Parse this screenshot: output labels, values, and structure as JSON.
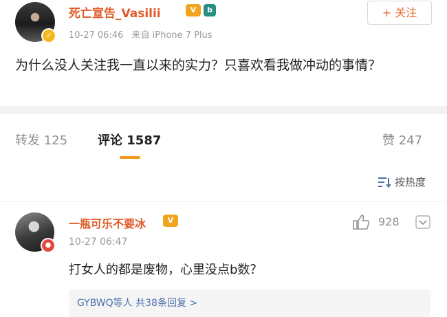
{
  "post": {
    "username": "死亡宣告_Vasilii",
    "vip_icon": "vip-crown-icon",
    "level_icon": "level-badge-icon",
    "avatar_badge": "verified-icon",
    "time": "10-27 06:46",
    "source": "来自 iPhone 7 Plus",
    "follow_label": "+ 关注",
    "text": "为什么没人关注我一直以来的实力？只喜欢看我做冲动的事情？"
  },
  "actions": {
    "repost": "转发 125",
    "comments": "评论 1587",
    "likes": "赞 247",
    "sort_label": "按热度"
  },
  "comment": {
    "username": "一瓶可乐不要冰",
    "time": "10-27 06:47",
    "like_count": "928",
    "text": "打女人的都是废物，心里没点b数？",
    "replies_who": "GYBWQ等人",
    "replies_count": "共38条回复 >"
  },
  "colors": {
    "accent_orange": "#e05a28",
    "tab_underline": "#f39a1e",
    "link_blue": "#4a6fa8"
  }
}
